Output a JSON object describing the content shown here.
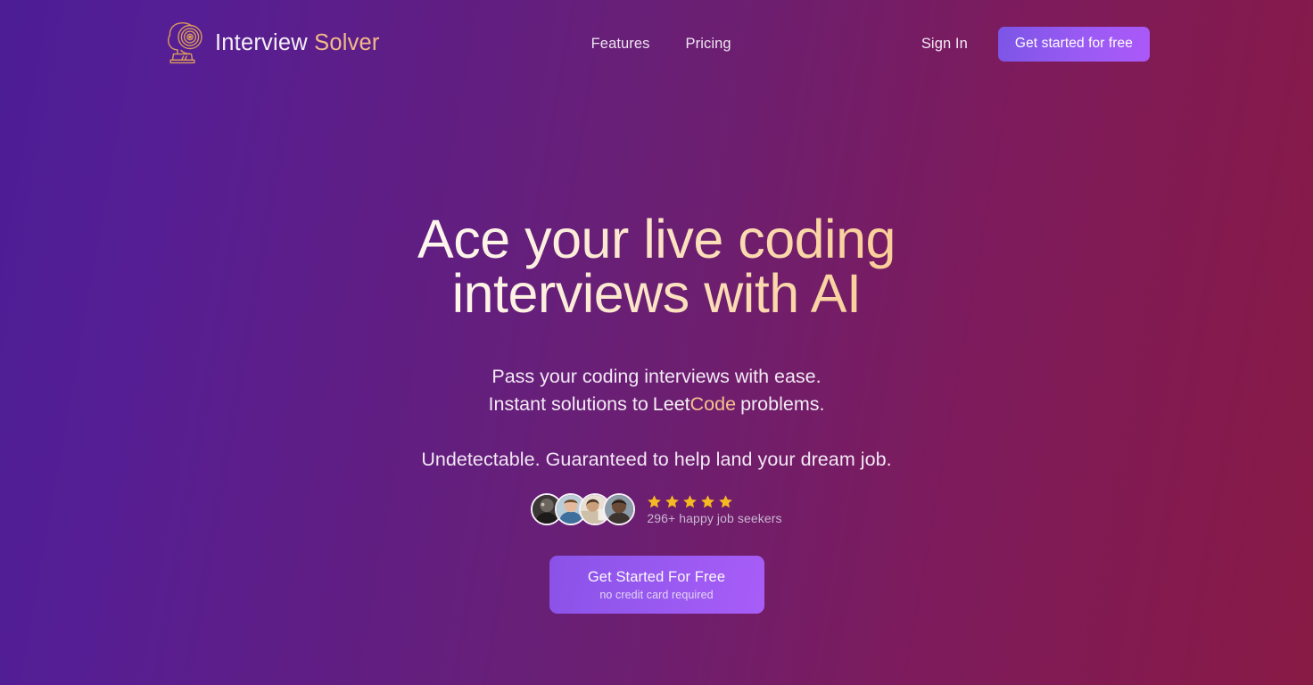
{
  "brand": {
    "logo_icon": "interview-solver-head-logo-icon",
    "name_primary": "Interview",
    "name_accent": " Solver"
  },
  "nav": {
    "links": [
      {
        "label": "Features"
      },
      {
        "label": "Pricing"
      }
    ],
    "sign_in_label": "Sign In",
    "cta_label": "Get started for free"
  },
  "hero": {
    "headline_line1": "Ace your live coding",
    "headline_line2": "interviews with AI",
    "sub_line1": "Pass your coding interviews with ease.",
    "sub_line2_prefix": "Instant solutions to",
    "sub_line2_brand_white": "Leet",
    "sub_line2_brand_accent": "Code",
    "sub_line2_suffix": "problems.",
    "guarantee": "Undetectable. Guaranteed to help land your dream job.",
    "cta_title": "Get Started For Free",
    "cta_subtitle": "no credit card required"
  },
  "social_proof": {
    "avatar_count": 4,
    "avatars": [
      {
        "name": "avatar-1",
        "tone": "#2e2b29"
      },
      {
        "name": "avatar-2",
        "tone": "#9fb4c6"
      },
      {
        "name": "avatar-3",
        "tone": "#d8c0a6"
      },
      {
        "name": "avatar-4",
        "tone": "#6d5344"
      }
    ],
    "star_count": 5,
    "stars_filled": 5,
    "seekers_text": "296+ happy job seekers"
  },
  "colors": {
    "bg_gradient_start": "#4C1D95",
    "bg_gradient_mid": "#6B1F72",
    "bg_gradient_end": "#881A45",
    "accent_purple": "#A855F7",
    "accent_tan": "#F6C28E",
    "star_gold": "#F5B921",
    "headline_gradient_start": "#FEFAF5",
    "headline_gradient_end": "#F9C98E"
  }
}
